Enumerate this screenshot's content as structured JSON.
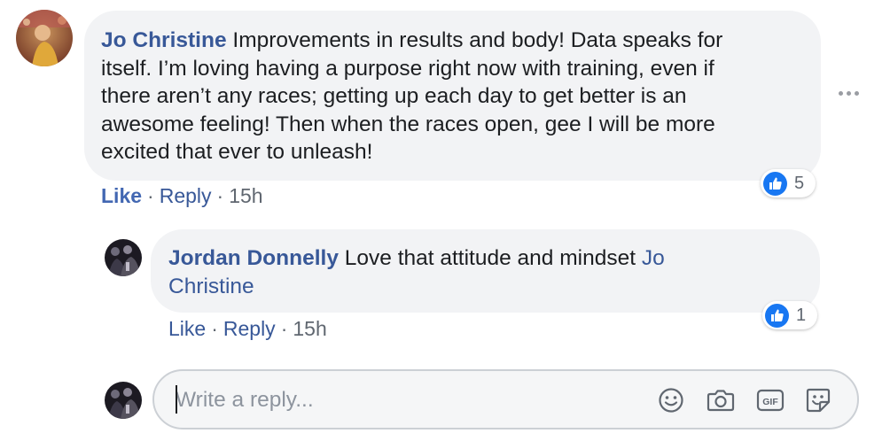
{
  "colors": {
    "author_link": "#385898",
    "like_blue": "#4267b2",
    "bubble_bg": "#f2f3f5",
    "reaction_blue": "#1877f2",
    "muted": "#606770"
  },
  "comment": {
    "author": "Jo Christine",
    "text_lines": [
      "Improvements in results and body! Data speaks for",
      "itself. I’m loving having a purpose right now with training, even if",
      "there aren’t any races; getting up each day to get better is an",
      "awesome feeling! Then when the races open, gee I will be more",
      "excited that ever to unleash!"
    ],
    "actions": {
      "like": "Like",
      "reply": "Reply",
      "time": "15h",
      "sep": "·"
    },
    "reaction": {
      "icon": "thumbs-up-icon",
      "count": "5"
    },
    "more_icon": "more-options-icon"
  },
  "reply": {
    "author": "Jordan Donnelly",
    "text": "Love that attitude and mindset",
    "mention_line1": "Jo",
    "mention_line2": "Christine",
    "actions": {
      "like": "Like",
      "reply": "Reply",
      "time": "15h",
      "sep": "·"
    },
    "reaction": {
      "icon": "thumbs-up-icon",
      "count": "1"
    }
  },
  "composer": {
    "placeholder": "Write a reply...",
    "icons": [
      "emoji-icon",
      "camera-icon",
      "gif-icon",
      "sticker-icon"
    ]
  }
}
